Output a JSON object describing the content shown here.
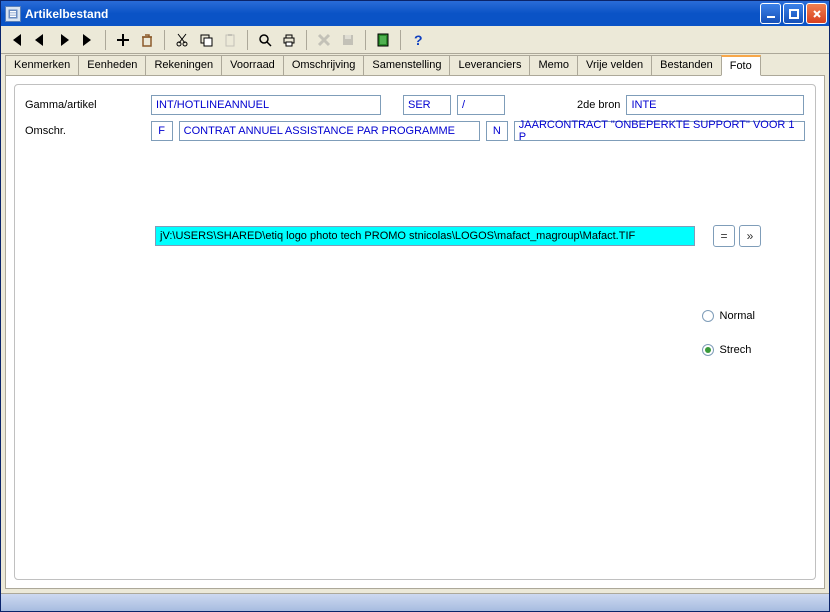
{
  "window": {
    "title": "Artikelbestand"
  },
  "tabs": {
    "items": [
      "Kenmerken",
      "Eenheden",
      "Rekeningen",
      "Voorraad",
      "Omschrijving",
      "Samenstelling",
      "Leveranciers",
      "Memo",
      "Vrije velden",
      "Bestanden",
      "Foto"
    ],
    "active": "Foto"
  },
  "fields": {
    "gamma_label": "Gamma/artikel",
    "gamma_value": "INT/HOTLINEANNUEL",
    "ser_value": "SER",
    "slash_value": "/",
    "bron2_label": "2de bron",
    "bron2_value": "INTE",
    "omschr_label": "Omschr.",
    "lang1_code": "F",
    "lang1_text": "CONTRAT ANNUEL ASSISTANCE PAR PROGRAMME",
    "lang2_code": "N",
    "lang2_text": "JAARCONTRACT \"ONBEPERKTE SUPPORT\" VOOR 1 P"
  },
  "photo": {
    "path": "jV:\\USERS\\SHARED\\etiq logo photo tech PROMO stnicolas\\LOGOS\\mafact_magroup\\Mafact.TIF",
    "btn_eq": "=",
    "btn_next": "»"
  },
  "radios": {
    "normal": "Normal",
    "stretch": "Strech"
  },
  "toolbar_icon_color": "#000"
}
